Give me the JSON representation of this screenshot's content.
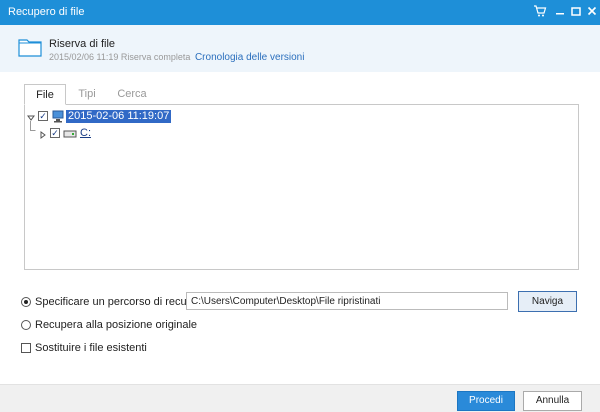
{
  "window": {
    "title": "Recupero di file"
  },
  "header": {
    "backup_name": "Riserva di file",
    "backup_info": "2015/02/06 11:19 Riserva completa",
    "history_link": "Cronologia delle versioni"
  },
  "tabs": [
    {
      "label": "File",
      "active": true
    },
    {
      "label": "Tipi",
      "active": false
    },
    {
      "label": "Cerca",
      "active": false
    }
  ],
  "tree": {
    "root": {
      "label": "2015-02-06 11:19:07",
      "checked": true,
      "expanded": true,
      "icon": "computer-icon"
    },
    "children": [
      {
        "label": "C:",
        "checked": true,
        "expanded": false,
        "icon": "drive-icon"
      }
    ]
  },
  "restore": {
    "option_custom_label": "Specificare un percorso di recupero:",
    "option_custom_selected": true,
    "path_value": "C:\\Users\\Computer\\Desktop\\File ripristinati",
    "browse_label": "Naviga",
    "option_original_label": "Recupera alla posizione originale",
    "option_original_selected": false,
    "replace_label": "Sostituire i file esistenti",
    "replace_checked": false
  },
  "footer": {
    "proceed_label": "Procedi",
    "cancel_label": "Annulla"
  },
  "colors": {
    "titlebar": "#1e8fd8",
    "header_bg": "#eef5fb",
    "selection": "#3169c6",
    "primary_button": "#2a8ad9"
  }
}
